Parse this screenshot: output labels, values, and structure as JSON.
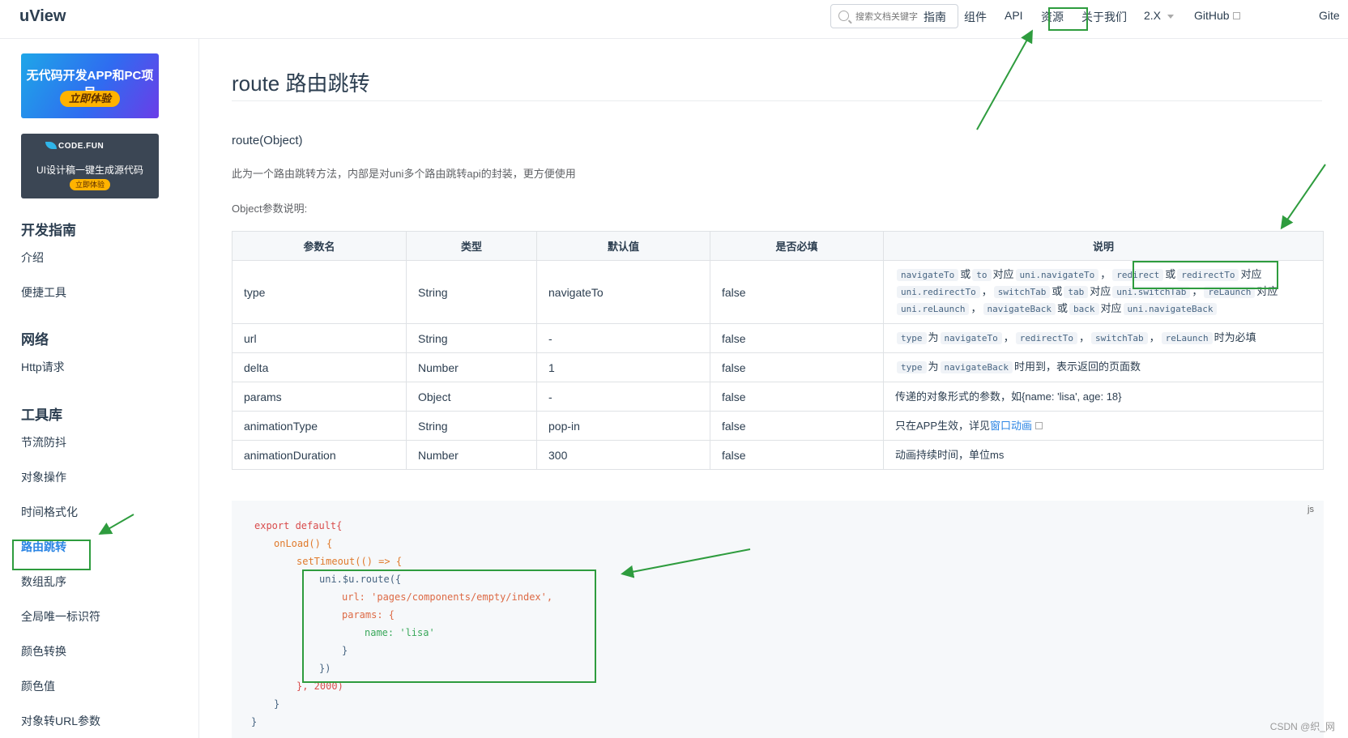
{
  "nav": {
    "logo": "uView",
    "search_placeholder": "搜索文档关键字",
    "items": [
      "指南",
      "组件",
      "API",
      "资源",
      "关于我们",
      "2.X",
      "GitHub",
      "Gite"
    ]
  },
  "sidebar": {
    "banner1": {
      "title": "无代码开发APP和PC项目",
      "button": "立即体验"
    },
    "banner2": {
      "brand": "CODE.FUN",
      "title": "UI设计稿一键生成源代码",
      "button": "立即体验"
    },
    "sections": [
      {
        "heading": "开发指南",
        "items": [
          "介绍",
          "便捷工具"
        ]
      },
      {
        "heading": "网络",
        "items": [
          "Http请求"
        ]
      },
      {
        "heading": "工具库",
        "items": [
          "节流防抖",
          "对象操作",
          "时间格式化",
          "路由跳转",
          "数组乱序",
          "全局唯一标识符",
          "颜色转换",
          "颜色值",
          "对象转URL参数"
        ]
      }
    ]
  },
  "content": {
    "title": "route 路由跳转",
    "subtitle": "route(Object)",
    "description": "此为一个路由跳转方法，内部是对uni多个路由跳转api的封装，更方便使用",
    "param_intro": "Object参数说明:",
    "table": {
      "headers": [
        "参数名",
        "类型",
        "默认值",
        "是否必填",
        "说明"
      ],
      "rows": [
        {
          "name": "type",
          "type": "String",
          "default": "navigateTo",
          "required": "false"
        },
        {
          "name": "url",
          "type": "String",
          "default": "-",
          "required": "false"
        },
        {
          "name": "delta",
          "type": "Number",
          "default": "1",
          "required": "false"
        },
        {
          "name": "params",
          "type": "Object",
          "default": "-",
          "required": "false",
          "desc": "传递的对象形式的参数，如{name: 'lisa', age: 18}"
        },
        {
          "name": "animationType",
          "type": "String",
          "default": "pop-in",
          "required": "false",
          "desc": "只在APP生效，详见",
          "desc_link": "窗口动画"
        },
        {
          "name": "animationDuration",
          "type": "Number",
          "default": "300",
          "required": "false",
          "desc": "动画持续时间，单位ms"
        }
      ],
      "type_desc": {
        "c1": "navigateTo",
        "w1": "或",
        "c2": "to",
        "w2": "对应",
        "c3": "uni.navigateTo",
        "w3": "，",
        "c4": "redirect",
        "w4": "或",
        "c5": "redirectTo",
        "w5": "对应",
        "c6": "uni.redirectTo",
        "w6": "，",
        "c7": "switchTab",
        "w7": "或",
        "c8": "tab",
        "w8": "对应",
        "c9": "uni.switchTab",
        "w9": "，",
        "c10": "reLaunch",
        "w10": "对应",
        "c11": "uni.reLaunch",
        "w11": "，",
        "c12": "navigateBack",
        "w12": "或",
        "c13": "back",
        "w13": "对应",
        "c14": "uni.navigateBack"
      },
      "url_desc": {
        "c1": "type",
        "w1": "为",
        "c2": "navigateTo",
        "w2": "，",
        "c3": "redirectTo",
        "w3": "，",
        "c4": "switchTab",
        "w4": "，",
        "c5": "reLaunch",
        "w5": "时为必填"
      },
      "delta_desc": {
        "c1": "type",
        "w1": "为",
        "c2": "navigateBack",
        "w2": "时用到，表示返回的页面数"
      }
    },
    "code": {
      "lang": "js",
      "lines": [
        "export default{",
        "onLoad() {",
        "setTimeout(() => {",
        "uni.$u.route({",
        "url: 'pages/components/empty/index',",
        "params: {",
        "name: 'lisa'",
        "}",
        "})",
        "}, 2000)",
        "}",
        "}"
      ]
    }
  },
  "watermark": "CSDN @织_网",
  "colors": {
    "annotation": "#2e9c3e",
    "accent": "#2b85e4"
  }
}
